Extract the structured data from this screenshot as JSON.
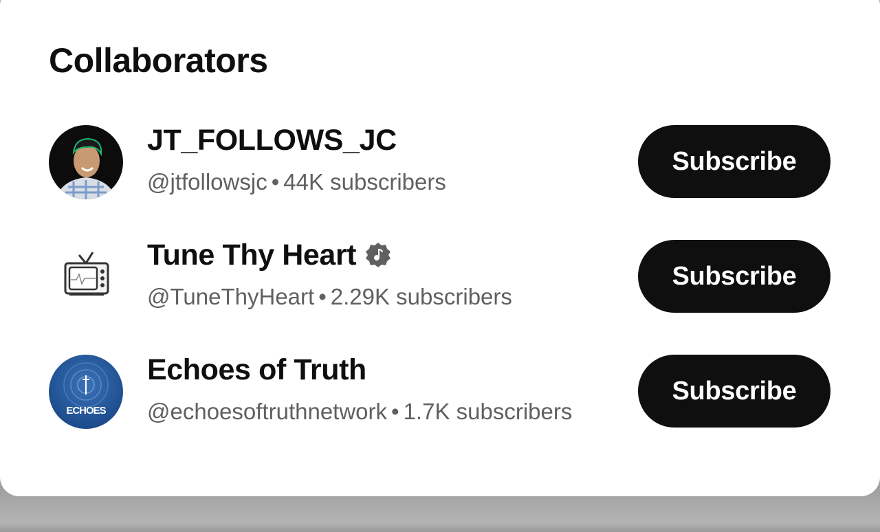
{
  "dialog": {
    "title": "Collaborators"
  },
  "collaborators": [
    {
      "name": "JT_FOLLOWS_JC",
      "handle": "@jtfollowsjc",
      "subscribers": "44K subscribers",
      "verified_music": false,
      "avatar_icon": "person-avatar",
      "button_label": "Subscribe"
    },
    {
      "name": "Tune Thy Heart",
      "handle": "@TuneThyHeart",
      "subscribers": "2.29K subscribers",
      "verified_music": true,
      "avatar_icon": "tv-avatar",
      "button_label": "Subscribe"
    },
    {
      "name": "Echoes of Truth",
      "handle": "@echoesoftruthnetwork",
      "subscribers": "1.7K subscribers",
      "verified_music": false,
      "avatar_icon": "echoes-logo-avatar",
      "avatar_text": "ECHOES",
      "button_label": "Subscribe"
    }
  ],
  "separator": "•",
  "colors": {
    "button_bg": "#0f0f0f",
    "button_text": "#ffffff",
    "meta_text": "#606060",
    "title_text": "#0f0f0f"
  }
}
